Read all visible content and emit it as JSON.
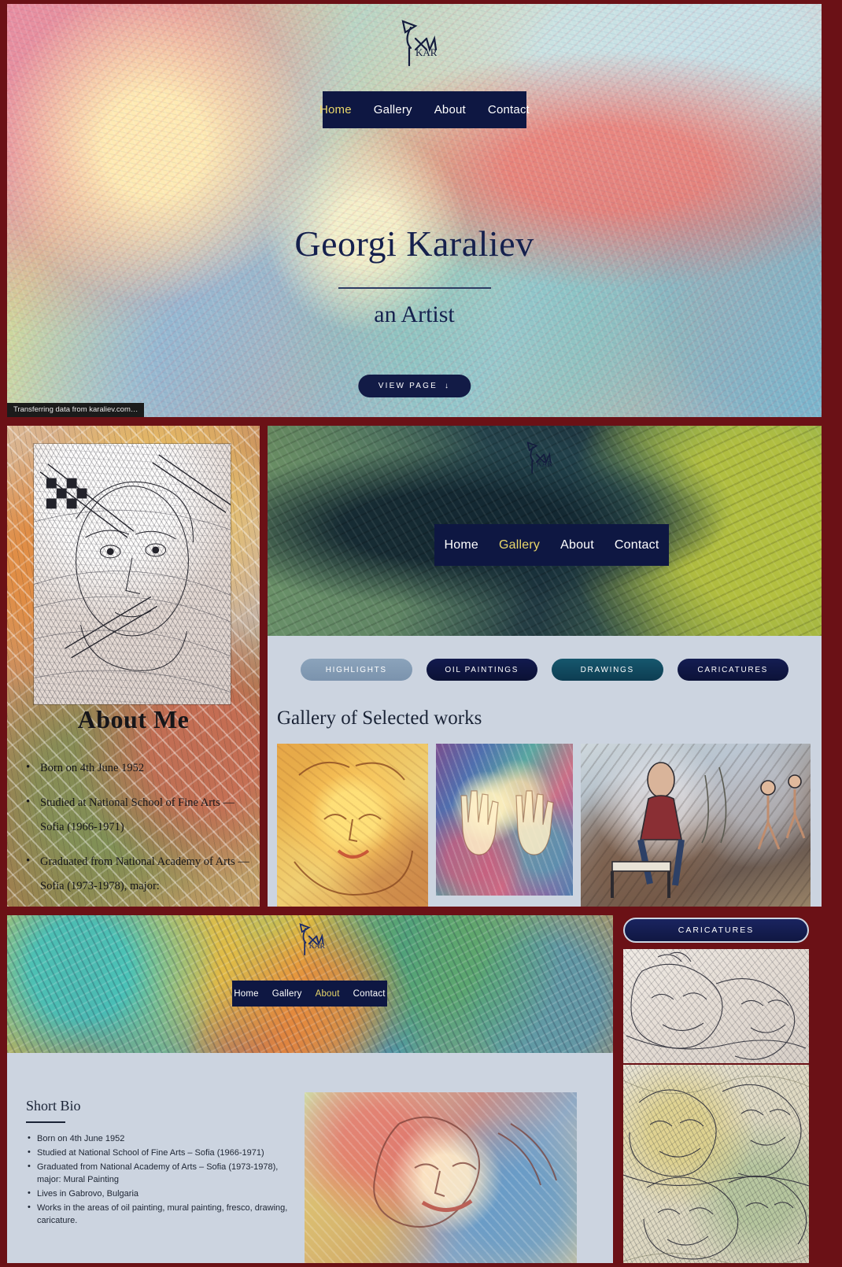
{
  "site": {
    "artist_name": "Georgi Karaliev",
    "tagline": "an Artist",
    "signature_initials": "KAR"
  },
  "hero": {
    "nav": [
      {
        "label": "Home",
        "active": true
      },
      {
        "label": "Gallery",
        "active": false
      },
      {
        "label": "About",
        "active": false
      },
      {
        "label": "Contact",
        "active": false
      }
    ],
    "title": "Georgi Karaliev",
    "subtitle": "an Artist",
    "cta_label": "VIEW PAGE",
    "cta_arrow": "↓",
    "status_text": "Transferring data from karaliev.com…",
    "nav_bg": "#0e1742",
    "title_color": "#15204d"
  },
  "about": {
    "heading": "About Me",
    "items": [
      "Born on 4th June 1952",
      "Studied at National School of Fine Arts — Sofia (1966-1971)",
      "Graduated from National Academy of Arts — Sofia (1973-1978), major:"
    ]
  },
  "gallery": {
    "nav": [
      {
        "label": "Home",
        "active": false
      },
      {
        "label": "Gallery",
        "active": true
      },
      {
        "label": "About",
        "active": false
      },
      {
        "label": "Contact",
        "active": false
      }
    ],
    "filters": [
      {
        "label": "HIGHLIGHTS",
        "active": true,
        "color": "#8ba3bb"
      },
      {
        "label": "OIL PAINTINGS",
        "active": false,
        "color": "#121a4e"
      },
      {
        "label": "DRAWINGS",
        "active": false,
        "color": "#16576e"
      },
      {
        "label": "CARICATURES",
        "active": false,
        "color": "#141d52"
      }
    ],
    "title": "Gallery of Selected works",
    "thumbnails": [
      {
        "name": "sun-face-painting"
      },
      {
        "name": "hands-abstract-painting"
      },
      {
        "name": "seated-man-piano-painting"
      }
    ]
  },
  "bio": {
    "nav": [
      {
        "label": "Home",
        "active": false
      },
      {
        "label": "Gallery",
        "active": false
      },
      {
        "label": "About",
        "active": true
      },
      {
        "label": "Contact",
        "active": false
      }
    ],
    "heading": "Short Bio",
    "items": [
      "Born on 4th June 1952",
      "Studied at National School of Fine Arts – Sofia (1966-1971)",
      "Graduated from National Academy of Arts – Sofia (1973-1978), major: Mural Painting",
      "Lives in Gabrovo, Bulgaria",
      "Works in the areas of oil painting, mural painting, fresco, drawing, caricature."
    ]
  },
  "caricatures": {
    "badge_label": "CARICATURES",
    "images": [
      {
        "name": "caricature-drawing-one"
      },
      {
        "name": "caricature-drawing-two"
      }
    ]
  },
  "colors": {
    "page_border": "#6b1116",
    "navy": "#0e1742",
    "accent_yellow": "#e9d76a",
    "panel_bg": "#ccd4e0"
  }
}
